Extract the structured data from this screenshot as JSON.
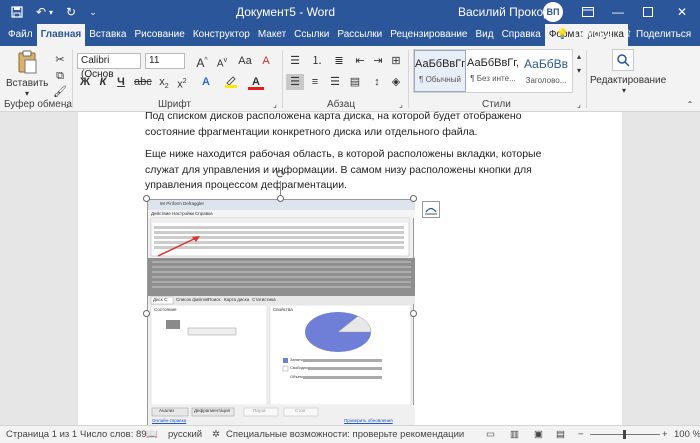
{
  "titlebar": {
    "doc_title": "Документ5  -  Word",
    "user_name": "Василий Прокоров",
    "user_initials": "ВП"
  },
  "tabs": [
    "Файл",
    "Главная",
    "Вставка",
    "Рисование",
    "Конструктор",
    "Макет",
    "Ссылки",
    "Рассылки",
    "Рецензирование",
    "Вид",
    "Справка",
    "Формат рисунка"
  ],
  "tabs_right": {
    "help": "Помощь",
    "share": "Поделиться"
  },
  "ribbon": {
    "paste_label": "Вставить",
    "clipboard_group": "Буфер обмена",
    "font_group": "Шрифт",
    "paragraph_group": "Абзац",
    "styles_group": "Стили",
    "editing_label": "Редактирование",
    "font_name": "Calibri (Основ",
    "font_size": "11",
    "bold": "Ж",
    "italic": "К",
    "underline": "Ч",
    "styles": [
      {
        "preview": "АаБбВвГг,",
        "name": "¶ Обычный"
      },
      {
        "preview": "АаБбВвГг,",
        "name": "¶ Без инте..."
      },
      {
        "preview": "АаБбВв",
        "name": "Заголово..."
      }
    ]
  },
  "document": {
    "para1": "Под списком дисков расположена карта диска, на которой будет отображено состояние фрагментации конкретного диска или отдельного файла.",
    "para2": "Еще ниже находится рабочая область, в которой расположены вкладки, которые служат для управления и информации. В самом низу расположены кнопки для управления процессом дефрагментации."
  },
  "embedded_image": {
    "title": "IM Piriform Defraggler",
    "menu": [
      "Действие",
      "Настройки",
      "Справка"
    ],
    "tabs": [
      "Диск C:",
      "Список файлов",
      "Поиск",
      "Карта диска",
      "Статистика"
    ],
    "state_label": "Состояние",
    "props_label": "Свойства",
    "buttons": [
      "Анализ",
      "Дефрагментация",
      "Пауза",
      "Стоп"
    ],
    "link_help": "Онлайн-справка",
    "link_update": "Проверить обновления",
    "legend": [
      "Занято",
      "Свободно",
      "Объем"
    ]
  },
  "status": {
    "page": "Страница 1 из 1",
    "words": "Число слов: 89",
    "lang": "русский",
    "accessibility": "Специальные возможности: проверьте рекомендации",
    "zoom": "100 %"
  },
  "colors": {
    "accent": "#2b579a",
    "pie_used": "#6f7ed6",
    "pie_free": "#e8e8e8"
  }
}
